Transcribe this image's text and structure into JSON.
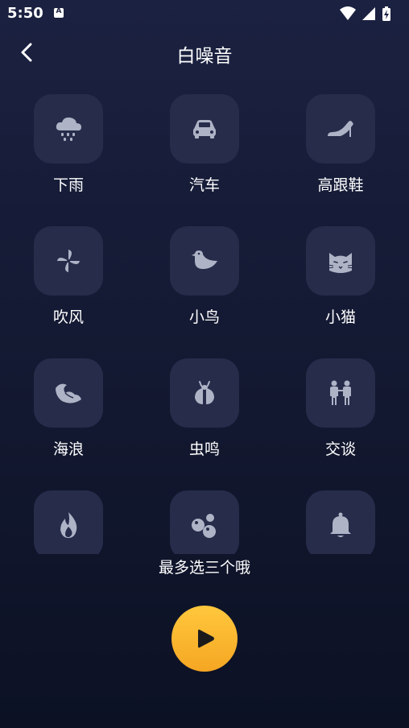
{
  "status": {
    "time": "5:50",
    "badge": "A"
  },
  "header": {
    "title": "白噪音"
  },
  "sounds": [
    {
      "label": "下雨",
      "icon": "rain-cloud-icon"
    },
    {
      "label": "汽车",
      "icon": "car-icon"
    },
    {
      "label": "高跟鞋",
      "icon": "high-heel-icon"
    },
    {
      "label": "吹风",
      "icon": "pinwheel-icon"
    },
    {
      "label": "小鸟",
      "icon": "bird-icon"
    },
    {
      "label": "小猫",
      "icon": "cat-icon"
    },
    {
      "label": "海浪",
      "icon": "wave-icon"
    },
    {
      "label": "虫鸣",
      "icon": "cicada-icon"
    },
    {
      "label": "交谈",
      "icon": "people-talking-icon"
    },
    {
      "label": "",
      "icon": "fire-icon"
    },
    {
      "label": "",
      "icon": "bubbles-icon"
    },
    {
      "label": "",
      "icon": "bell-icon"
    }
  ],
  "hint": "最多选三个哦",
  "colors": {
    "background": "#1b2140",
    "tile": "#262c4a",
    "icon": "#aeb3c6",
    "accent": "#ffb62e"
  }
}
